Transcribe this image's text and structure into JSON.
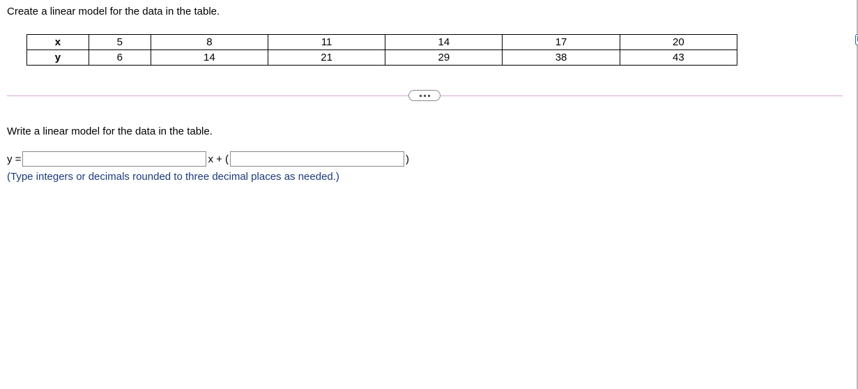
{
  "question": "Create a linear model for the data in the table.",
  "chart_data": {
    "type": "table",
    "rows": [
      {
        "label": "x",
        "values": [
          "5",
          "8",
          "11",
          "14",
          "17",
          "20"
        ]
      },
      {
        "label": "y",
        "values": [
          "6",
          "14",
          "21",
          "29",
          "38",
          "43"
        ]
      }
    ]
  },
  "sub_question": "Write a linear model for the data in the table.",
  "equation": {
    "y_equals": "y =",
    "x_plus": "x + (",
    "close_paren": ")"
  },
  "hint": "(Type integers or decimals rounded to three decimal places as needed.)"
}
